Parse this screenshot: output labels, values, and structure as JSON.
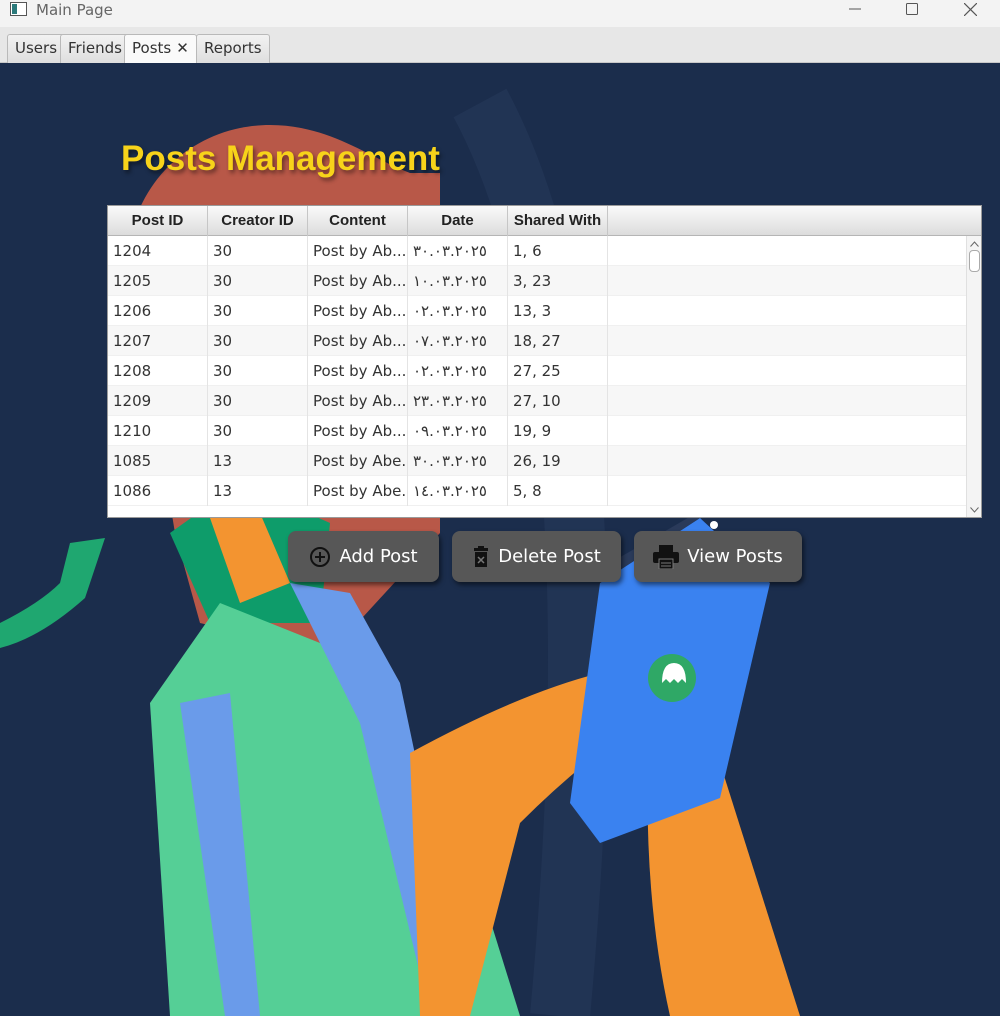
{
  "window": {
    "title": "Main Page"
  },
  "tabs": [
    {
      "label": "Users"
    },
    {
      "label": "Friends"
    },
    {
      "label": "Posts",
      "closable": true,
      "active": true
    },
    {
      "label": "Reports"
    }
  ],
  "page": {
    "title": "Posts Management"
  },
  "table": {
    "columns": [
      "Post ID",
      "Creator ID",
      "Content",
      "Date",
      "Shared With"
    ],
    "rows": [
      [
        "1204",
        "30",
        "Post by Ab...",
        "٣٠.٠٣.٢٠٢٥",
        "1, 6"
      ],
      [
        "1205",
        "30",
        "Post by Ab...",
        "١٠.٠٣.٢٠٢٥",
        "3, 23"
      ],
      [
        "1206",
        "30",
        "Post by Ab...",
        "٠٢.٠٣.٢٠٢٥",
        "13, 3"
      ],
      [
        "1207",
        "30",
        "Post by Ab...",
        "٠٧.٠٣.٢٠٢٥",
        "18, 27"
      ],
      [
        "1208",
        "30",
        "Post by Ab...",
        "٠٢.٠٣.٢٠٢٥",
        "27, 25"
      ],
      [
        "1209",
        "30",
        "Post by Ab...",
        "٢٣.٠٣.٢٠٢٥",
        "27, 10"
      ],
      [
        "1210",
        "30",
        "Post by Ab...",
        "٠٩.٠٣.٢٠٢٥",
        "19, 9"
      ],
      [
        "1085",
        "13",
        "Post by Abe...",
        "٣٠.٠٣.٢٠٢٥",
        "26, 19"
      ],
      [
        "1086",
        "13",
        "Post by Abe...",
        "١٤.٠٣.٢٠٢٥",
        "5, 8"
      ]
    ]
  },
  "buttons": {
    "add": "Add Post",
    "delete": "Delete Post",
    "view": "View  Posts"
  },
  "colors": {
    "background": "#1b2d4c",
    "title": "#f7d31a",
    "button": "#575757"
  },
  "icons": {
    "add": "plus-circle-icon",
    "delete": "trash-icon",
    "view": "printer-icon"
  }
}
